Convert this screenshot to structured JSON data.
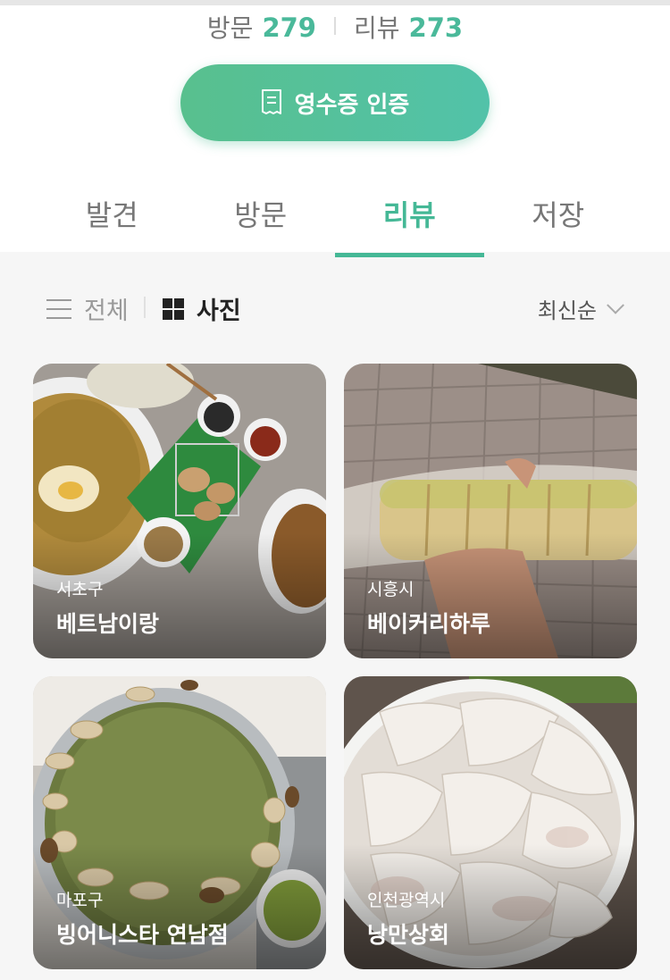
{
  "stats": {
    "visit_label": "방문",
    "visit_count": "279",
    "review_label": "리뷰",
    "review_count": "273"
  },
  "receipt_button": {
    "label": "영수증 인증",
    "icon": "receipt-icon"
  },
  "tabs": [
    {
      "label": "발견",
      "active": false
    },
    {
      "label": "방문",
      "active": false
    },
    {
      "label": "리뷰",
      "active": true
    },
    {
      "label": "저장",
      "active": false
    }
  ],
  "filter": {
    "all_label": "전체",
    "all_icon": "list-icon",
    "photo_label": "사진",
    "photo_icon": "grid-icon",
    "sort_label": "최신순",
    "sort_icon": "chevron-down-icon"
  },
  "cards": [
    {
      "region": "서초구",
      "name": "베트남이랑"
    },
    {
      "region": "시흥시",
      "name": "베이커리하루"
    },
    {
      "region": "마포구",
      "name": "빙어니스타 연남점"
    },
    {
      "region": "인천광역시",
      "name": "낭만상회"
    }
  ],
  "colors": {
    "accent": "#45b896",
    "button_start": "#58c08e",
    "button_end": "#52c2a9"
  }
}
